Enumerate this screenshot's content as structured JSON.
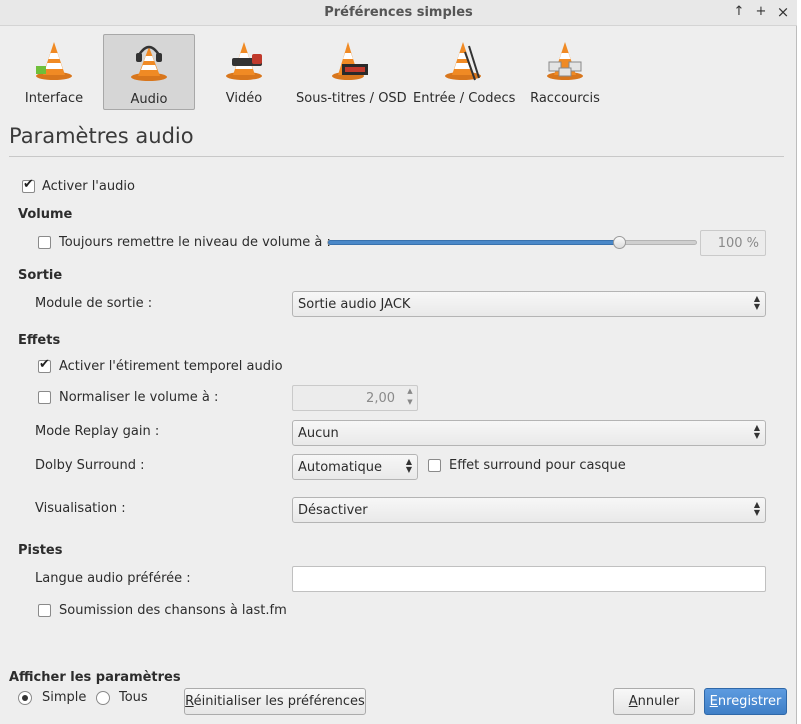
{
  "window": {
    "title": "Préférences simples",
    "controls": [
      "↑",
      "+",
      "×"
    ]
  },
  "tabs": [
    {
      "label": "Interface",
      "icon": "cone-icon"
    },
    {
      "label": "Audio",
      "icon": "headphones-cone-icon",
      "active": true
    },
    {
      "label": "Vidéo",
      "icon": "film-cone-icon"
    },
    {
      "label": "Sous-titres / OSD",
      "icon": "subtitles-cone-icon"
    },
    {
      "label": "Entrée / Codecs",
      "icon": "cable-cone-icon"
    },
    {
      "label": "Raccourcis",
      "icon": "keyboard-cone-icon"
    }
  ],
  "page": {
    "title": "Paramètres audio"
  },
  "audio": {
    "enable_label": "Activer l'audio",
    "enable_checked": true
  },
  "volume": {
    "section": "Volume",
    "reset_label": "Toujours remettre le niveau de volume à :",
    "reset_checked": false,
    "level_text": "100 %",
    "level_fraction": 0.79
  },
  "output": {
    "section": "Sortie",
    "module_label": "Module de sortie :",
    "module_value": "Sortie audio JACK"
  },
  "effects": {
    "section": "Effets",
    "stretch_label": "Activer l'étirement temporel audio",
    "stretch_checked": true,
    "normalize_label": "Normaliser le volume à :",
    "normalize_checked": false,
    "normalize_value": "2,00",
    "replay_label": "Mode Replay gain :",
    "replay_value": "Aucun",
    "dolby_label": "Dolby Surround :",
    "dolby_value": "Automatique",
    "headphone_label": "Effet surround pour casque",
    "headphone_checked": false,
    "visual_label": "Visualisation :",
    "visual_value": "Désactiver"
  },
  "tracks": {
    "section": "Pistes",
    "lang_label": "Langue audio préférée :",
    "lang_value": "",
    "lastfm_label": "Soumission des chansons à last.fm",
    "lastfm_checked": false
  },
  "footer": {
    "show_label": "Afficher les paramètres",
    "simple_label": "Simple",
    "all_label": "Tous",
    "selected": "Simple",
    "reset_first": "R",
    "reset_rest": "éinitialiser les préférences",
    "cancel_first": "A",
    "cancel_rest": "nnuler",
    "save_first": "E",
    "save_rest": "nregistrer"
  },
  "colors": {
    "accent": "#3f7fc7",
    "cone_orange": "#f08a24"
  }
}
